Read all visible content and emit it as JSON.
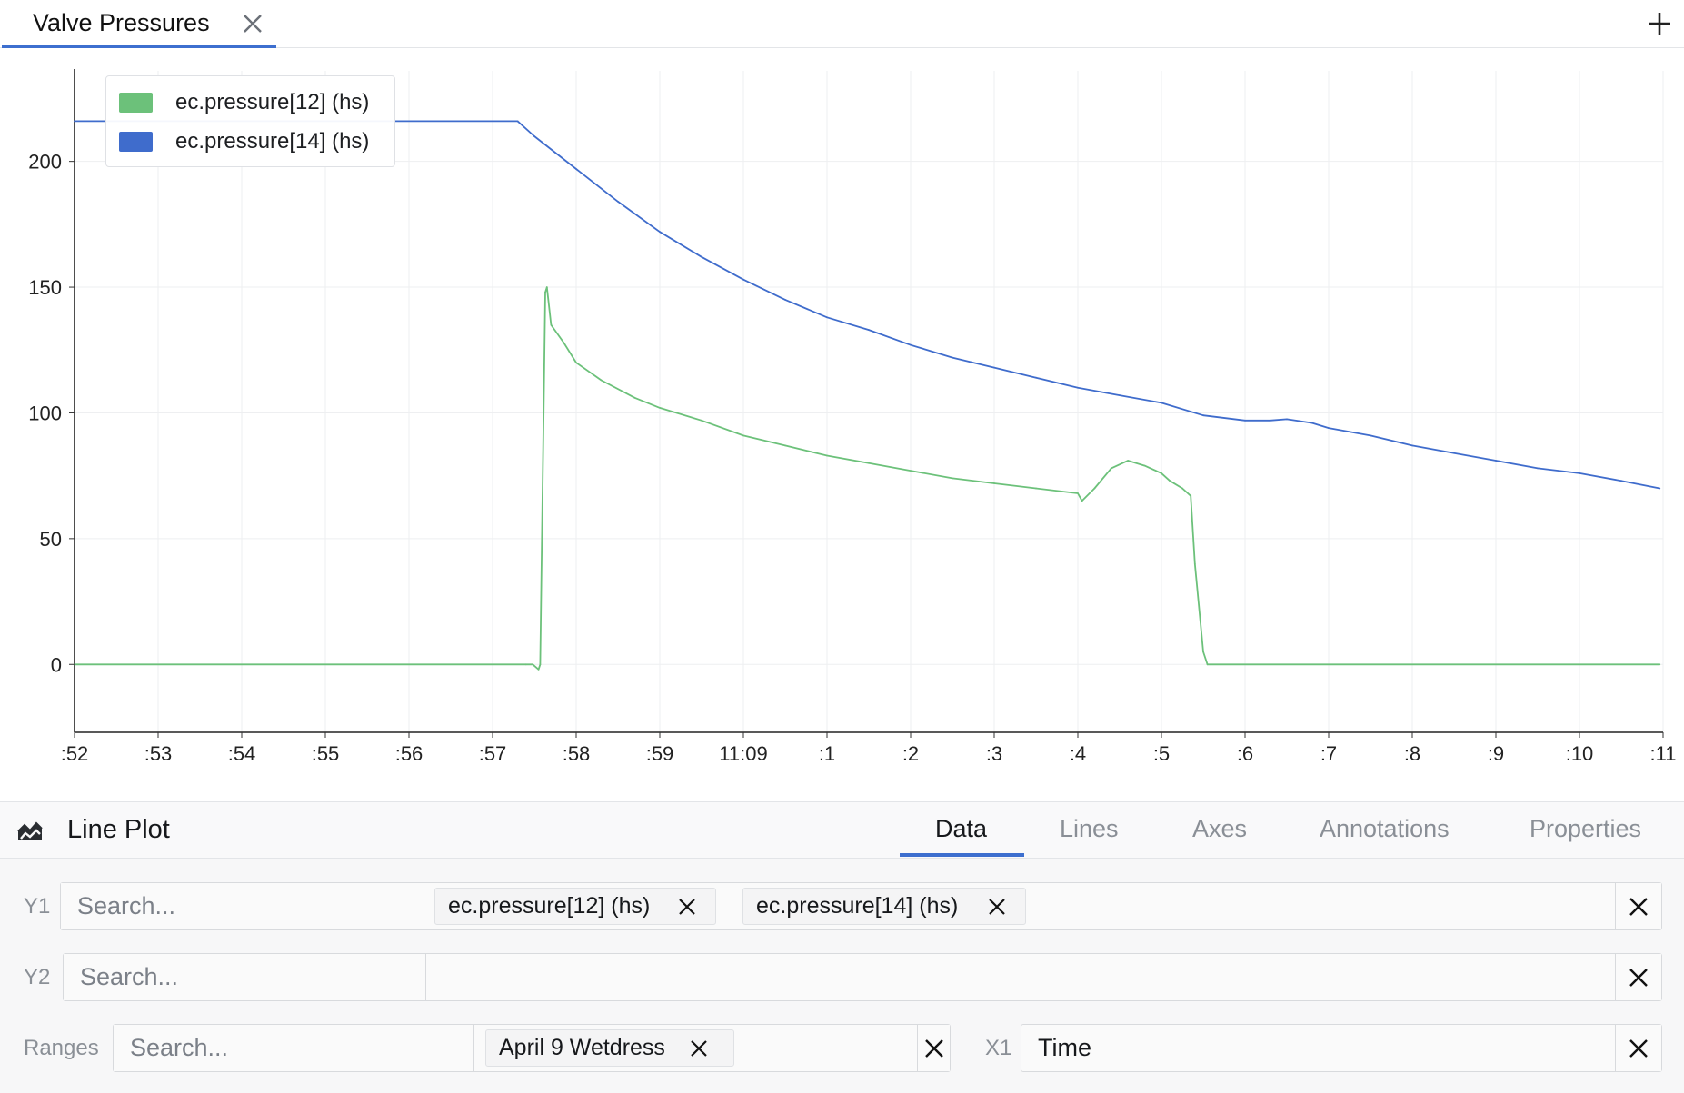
{
  "tab": {
    "title": "Valve Pressures"
  },
  "chart_data": {
    "type": "line",
    "title": "",
    "xlabel": "",
    "ylabel": "",
    "x_unit": "minutes",
    "x_ticks": [
      ":52",
      ":53",
      ":54",
      ":55",
      ":56",
      ":57",
      ":58",
      ":59",
      "11:09",
      ":1",
      ":2",
      ":3",
      ":4",
      ":5",
      ":6",
      ":7",
      ":8",
      ":9",
      ":10",
      ":11"
    ],
    "xlim": [
      0,
      19
    ],
    "y_ticks": [
      "200",
      "150",
      "100",
      "50",
      "0"
    ],
    "y_tick_values": [
      200,
      150,
      100,
      50,
      0
    ],
    "ylim": [
      -27,
      236
    ],
    "grid": true,
    "legend_position": "top-left",
    "series": [
      {
        "name": "ec.pressure[12] (hs)",
        "color": "#6cc17a",
        "x": [
          0,
          5.4,
          5.48,
          5.55,
          5.57,
          5.63,
          5.65,
          5.7,
          5.85,
          6,
          6.3,
          6.7,
          7.0,
          7.5,
          8,
          8.5,
          9,
          9.5,
          10,
          10.5,
          11,
          11.5,
          12,
          12.05,
          12.2,
          12.4,
          12.6,
          12.8,
          13.0,
          13.1,
          13.25,
          13.35,
          13.4,
          13.5,
          13.55,
          18.96
        ],
        "y": [
          0,
          0,
          0,
          -2,
          0,
          148,
          150,
          135,
          128,
          120,
          113,
          106,
          102,
          97,
          91,
          87,
          83,
          80,
          77,
          74,
          72,
          70,
          68,
          65,
          70,
          78,
          81,
          79,
          76,
          73,
          70,
          67,
          40,
          5,
          0,
          0
        ]
      },
      {
        "name": "ec.pressure[14] (hs)",
        "color": "#3f6ccc",
        "x": [
          0,
          5.3,
          5.5,
          6,
          6.5,
          7,
          7.5,
          8,
          8.5,
          9,
          9.5,
          10,
          10.5,
          11,
          11.5,
          12,
          12.5,
          13,
          13.5,
          14,
          14.3,
          14.5,
          14.8,
          15,
          15.5,
          16,
          16.5,
          17,
          17.5,
          18,
          18.5,
          18.96
        ],
        "y": [
          216,
          216,
          210,
          197,
          184,
          172,
          162,
          153,
          145,
          138,
          133,
          127,
          122,
          118,
          114,
          110,
          107,
          104,
          99,
          97,
          97,
          97.5,
          96,
          94,
          91,
          87,
          84,
          81,
          78,
          76,
          73,
          70
        ]
      }
    ]
  },
  "panel": {
    "title": "Line Plot",
    "tabs": [
      "Data",
      "Lines",
      "Axes",
      "Annotations",
      "Properties"
    ],
    "y1": {
      "label": "Y1",
      "placeholder": "Search...",
      "chips": [
        "ec.pressure[12] (hs)",
        "ec.pressure[14] (hs)"
      ]
    },
    "y2": {
      "label": "Y2",
      "placeholder": "Search..."
    },
    "ranges": {
      "label": "Ranges",
      "placeholder": "Search...",
      "chips": [
        "April 9 Wetdress"
      ]
    },
    "x1": {
      "label": "X1",
      "value": "Time"
    }
  }
}
